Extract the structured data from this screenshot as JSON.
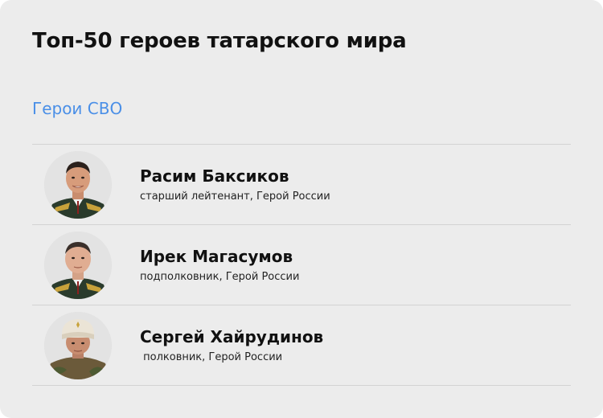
{
  "page": {
    "title": "Топ-50 героев татарского мира",
    "section_label": "Герои СВО"
  },
  "heroes": [
    {
      "name": "Расим Баксиков",
      "rank": "старший лейтенант, Герой России",
      "photo_icon": "portrait-photo"
    },
    {
      "name": "Ирек Магасумов",
      "rank": "подполковник, Герой России",
      "photo_icon": "portrait-photo"
    },
    {
      "name": "Сергей Хайрудинов",
      "rank": " полковник, Герой России",
      "photo_icon": "portrait-photo"
    }
  ],
  "colors": {
    "background": "#ececec",
    "accent_link": "#4a8fe7",
    "divider": "#d3d3d3",
    "text": "#111111"
  }
}
